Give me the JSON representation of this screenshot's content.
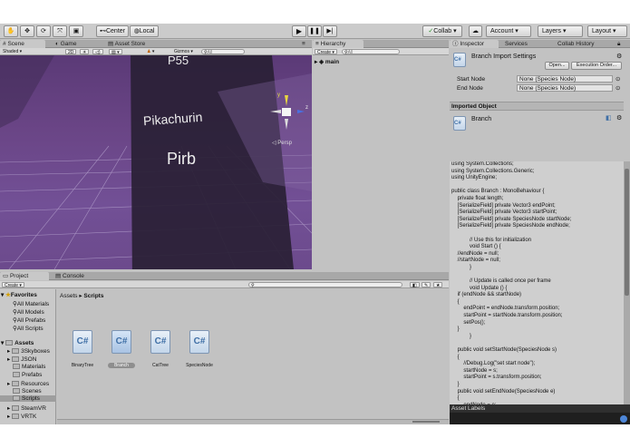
{
  "toolbar": {
    "pivot": "Center",
    "space": "Local",
    "collab": "Collab",
    "account": "Account",
    "layers": "Layers",
    "layout": "Layout"
  },
  "scene": {
    "tab_scene": "Scene",
    "tab_game": "Game",
    "tab_store": "Asset Store",
    "shading": "Shaded",
    "mode_2d": "2D",
    "gizmos": "Gizmos",
    "search_placeholder": "All",
    "persp": "Persp",
    "board_top": "P55",
    "board_mid": "Pikachurin",
    "board_bot": "Pirb",
    "gizmo_x": "x",
    "gizmo_z": "z"
  },
  "hierarchy": {
    "title": "Hierarchy",
    "create": "Create",
    "search": "All",
    "root": "main"
  },
  "inspector": {
    "tab_inspector": "Inspector",
    "tab_services": "Services",
    "tab_collab": "Collab History",
    "title": "Branch Import Settings",
    "open_btn": "Open...",
    "exec_btn": "Execution Order...",
    "start_label": "Start Node",
    "start_value": "None (Species Node)",
    "end_label": "End Node",
    "end_value": "None (Species Node)",
    "imported_header": "Imported Object",
    "imported_name": "Branch",
    "asset_labels": "Asset Labels"
  },
  "code_lines": [
    "using System.Collections;",
    "using System.Collections.Generic;",
    "using UnityEngine;",
    "",
    "public class Branch : MonoBehaviour {",
    "    private float length;",
    "    [SerializeField] private Vector3 endPoint;",
    "    [SerializeField] private Vector3 startPoint;",
    "    [SerializeField] private SpeciesNode startNode;",
    "    [SerializeField] private SpeciesNode endNode;",
    "",
    "            // Use this for initialization",
    "            void Start () {",
    "    //endNode = null;",
    "    //startNode = null;",
    "            }",
    "",
    "            // Update is called once per frame",
    "            void Update () {",
    "    if (endNode && startNode)",
    "    {",
    "        endPoint = endNode.transform.position;",
    "        startPoint = startNode.transform.position;",
    "        setPos();",
    "    }",
    "            }",
    "",
    "    public void setStartNode(SpeciesNode s)",
    "    {",
    "        //Debug.Log(\"set start node\");",
    "        startNode = s;",
    "        startPoint = s.transform.position;",
    "    }",
    "    public void setEndNode(SpeciesNode e)",
    "    {",
    "        endNode = e;",
    "        endPoint = e.transform.position;",
    "    }",
    "",
    "    public void setPos()"
  ],
  "project": {
    "tab_project": "Project",
    "tab_console": "Console",
    "create": "Create",
    "favorites": "Favorites",
    "fav_items": [
      "All Materials",
      "All Models",
      "All Prefabs",
      "All Scripts"
    ],
    "assets": "Assets",
    "asset_items": [
      "3Skyboxes",
      "JSON",
      "Materials",
      "Prefabs",
      "Resources",
      "Scenes",
      "Scripts",
      "SteamVR",
      "VRTK"
    ],
    "breadcrumb_assets": "Assets",
    "breadcrumb_sep": "▸",
    "breadcrumb_scripts": "Scripts",
    "files": [
      "BinaryTree",
      "Branch",
      "CatTree",
      "SpeciesNode"
    ]
  }
}
